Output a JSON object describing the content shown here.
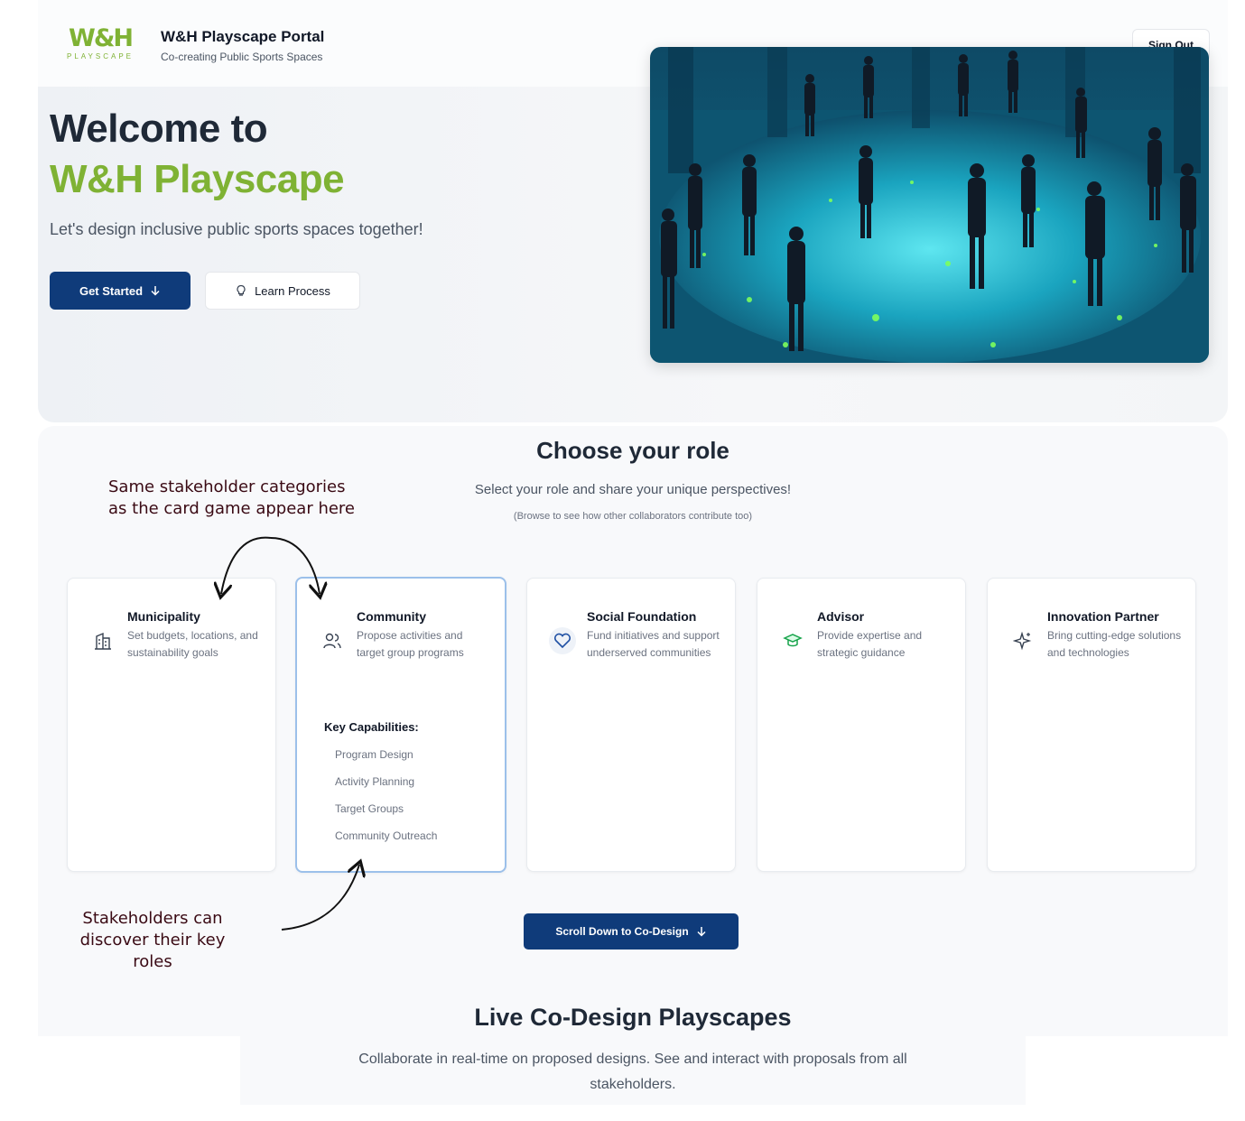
{
  "header": {
    "logo_text": "W&H",
    "logo_sub": "PLAYSCAPE",
    "portal_title": "W&H Playscape Portal",
    "portal_subtitle": "Co-creating Public Sports Spaces",
    "signout_label": "Sign Out"
  },
  "hero": {
    "title_line1": "Welcome to",
    "title_line2": "W&H Playscape",
    "tagline": "Let's design inclusive public sports spaces together!",
    "primary_button": "Get Started",
    "secondary_button": "Learn Process",
    "brand_color": "#7fb234",
    "button_color": "#0f3b7a"
  },
  "roles": {
    "title": "Choose your role",
    "subtitle": "Select your role and share your unique perspectives!",
    "note": "(Browse to see how other collaborators contribute too)",
    "cards": [
      {
        "title": "Municipality",
        "description": "Set budgets, locations, and sustainability goals",
        "icon": "building-icon"
      },
      {
        "title": "Community",
        "description": "Propose activities and target group programs",
        "icon": "users-icon",
        "capabilities_title": "Key Capabilities:",
        "capabilities": [
          "Program Design",
          "Activity Planning",
          "Target Groups",
          "Community Outreach"
        ]
      },
      {
        "title": "Social Foundation",
        "description": "Fund initiatives and support underserved communities",
        "icon": "heart-icon"
      },
      {
        "title": "Advisor",
        "description": "Provide expertise and strategic guidance",
        "icon": "graduation-cap-icon"
      },
      {
        "title": "Innovation Partner",
        "description": "Bring cutting-edge solutions and technologies",
        "icon": "sparkles-icon"
      }
    ],
    "scroll_button": "Scroll Down to Co-Design"
  },
  "annotations": {
    "top_line1": "Same stakeholder categories",
    "top_line2": "as the card game appear here",
    "bottom_line1": "Stakeholders can",
    "bottom_line2": "discover their key roles"
  },
  "live": {
    "title": "Live Co-Design Playscapes",
    "description": "Collaborate in real-time on proposed designs. See and interact with proposals from all stakeholders."
  }
}
